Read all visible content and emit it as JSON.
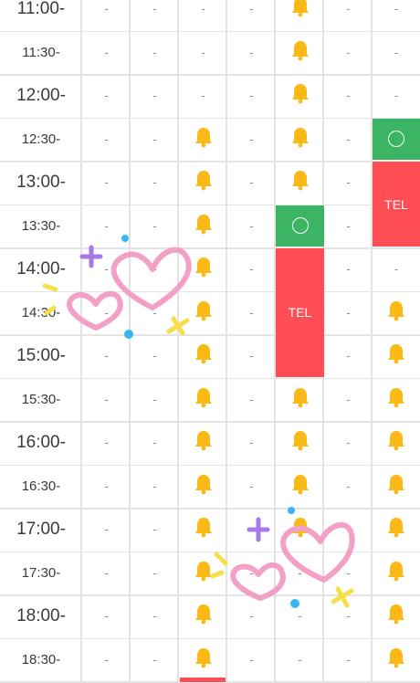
{
  "colors": {
    "available": "#3bb563",
    "phone_only": "#ff4d55",
    "bell": "#fbb917",
    "heart": "#f2a0c5",
    "sparkle_purple": "#a779e9",
    "sparkle_yellow": "#f5e04a",
    "dot_blue": "#39b6ef"
  },
  "slots": [
    {
      "time": "11:00-",
      "cells": [
        "-",
        "-",
        "-",
        "-",
        "bell",
        "-",
        "-"
      ]
    },
    {
      "time": "11:30-",
      "cells": [
        "-",
        "-",
        "-",
        "-",
        "bell",
        "-",
        "-"
      ]
    },
    {
      "time": "12:00-",
      "cells": [
        "-",
        "-",
        "-",
        "-",
        "bell",
        "-",
        "-"
      ]
    },
    {
      "time": "12:30-",
      "cells": [
        "-",
        "-",
        "bell",
        "-",
        "bell",
        "-",
        "open"
      ]
    },
    {
      "time": "13:00-",
      "cells": [
        "-",
        "-",
        "bell",
        "-",
        "bell",
        "-",
        "tel"
      ]
    },
    {
      "time": "13:30-",
      "cells": [
        "-",
        "-",
        "bell",
        "-",
        "open",
        "-",
        "tel"
      ]
    },
    {
      "time": "14:00-",
      "cells": [
        "-",
        "-",
        "bell",
        "-",
        "tel",
        "-",
        "-"
      ]
    },
    {
      "time": "14:30-",
      "cells": [
        "-",
        "-",
        "bell",
        "-",
        "tel",
        "-",
        "bell"
      ]
    },
    {
      "time": "15:00-",
      "cells": [
        "-",
        "-",
        "bell",
        "-",
        "tel",
        "-",
        "bell"
      ]
    },
    {
      "time": "15:30-",
      "cells": [
        "-",
        "-",
        "bell",
        "-",
        "bell",
        "-",
        "bell"
      ]
    },
    {
      "time": "16:00-",
      "cells": [
        "-",
        "-",
        "bell",
        "-",
        "bell",
        "-",
        "bell"
      ]
    },
    {
      "time": "16:30-",
      "cells": [
        "-",
        "-",
        "bell",
        "-",
        "bell",
        "-",
        "bell"
      ]
    },
    {
      "time": "17:00-",
      "cells": [
        "-",
        "-",
        "bell",
        "-",
        "bell",
        "-",
        "bell"
      ]
    },
    {
      "time": "17:30-",
      "cells": [
        "-",
        "-",
        "bell",
        "-",
        "-",
        "-",
        "bell"
      ]
    },
    {
      "time": "18:00-",
      "cells": [
        "-",
        "-",
        "bell",
        "-",
        "-",
        "-",
        "bell"
      ]
    },
    {
      "time": "18:30-",
      "cells": [
        "-",
        "-",
        "bell",
        "-",
        "-",
        "-",
        "bell"
      ]
    }
  ],
  "labels": {
    "tel": "TEL"
  },
  "decorations": [
    "heart-sticker",
    "heart-sticker",
    "sparkle-sticker"
  ]
}
